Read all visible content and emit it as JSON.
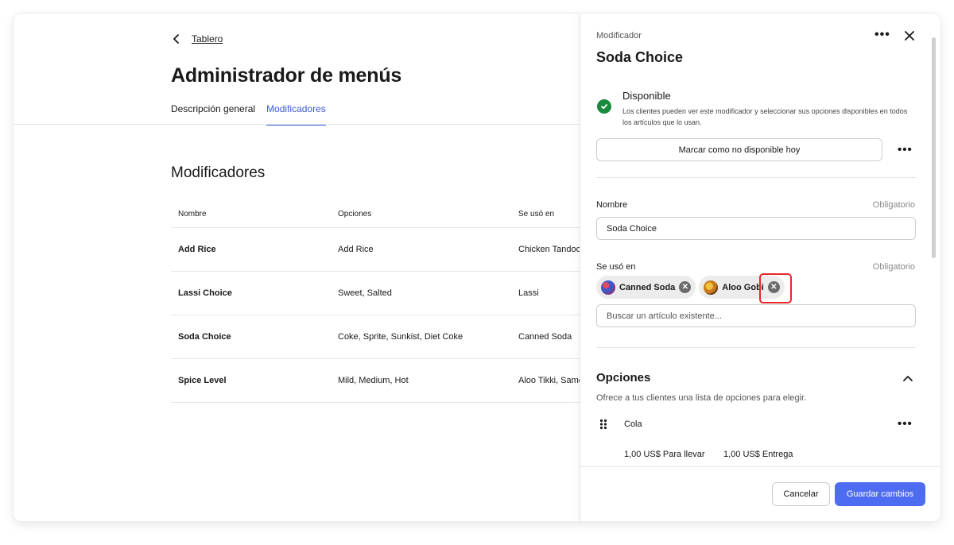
{
  "header": {
    "back_label": "Tablero",
    "title": "Administrador de menús",
    "tabs": [
      {
        "label": "Descripción general",
        "active": false
      },
      {
        "label": "Modificadores",
        "active": true
      }
    ]
  },
  "main": {
    "section_title": "Modificadores",
    "columns": [
      "Nombre",
      "Opciones",
      "Se usó en"
    ],
    "rows": [
      {
        "name": "Add Rice",
        "options": "Add Rice",
        "used_in": "Chicken Tandoo"
      },
      {
        "name": "Lassi Choice",
        "options": "Sweet, Salted",
        "used_in": "Lassi"
      },
      {
        "name": "Soda Choice",
        "options": "Coke, Sprite, Sunkist, Diet Coke",
        "used_in": "Canned Soda"
      },
      {
        "name": "Spice Level",
        "options": "Mild, Medium, Hot",
        "used_in": "Aloo Tikki, Samo"
      }
    ]
  },
  "panel": {
    "eyebrow": "Modificador",
    "title": "Soda Choice",
    "availability": {
      "title": "Disponible",
      "description": "Los clientes pueden ver este modificador y seleccionar sus opciones disponibles en todos los artículos que lo usan.",
      "button_label": "Marcar como no disponible hoy"
    },
    "name_field": {
      "label": "Nombre",
      "required": "Obligatorio",
      "value": "Soda Choice"
    },
    "used_in_field": {
      "label": "Se usó en",
      "required": "Obligatorio",
      "chips": [
        {
          "label": "Canned Soda",
          "icon": "canned-soda-thumbnail"
        },
        {
          "label": "Aloo Gobi",
          "icon": "aloo-gobi-thumbnail"
        }
      ],
      "search_placeholder": "Buscar un artículo existente..."
    },
    "options": {
      "title": "Opciones",
      "description": "Ofrece a tus clientes una lista de opciones para elegir.",
      "items": [
        {
          "name": "Cola",
          "price_pickup": "1,00 US$ Para llevar",
          "price_delivery": "1,00 US$ Entrega"
        }
      ]
    },
    "footer": {
      "cancel_label": "Cancelar",
      "save_label": "Guardar cambios"
    }
  },
  "colors": {
    "accent": "#3b5bdb",
    "primary_button": "#4d6cf2",
    "success": "#1a8a3e",
    "highlight": "#e8272b"
  }
}
